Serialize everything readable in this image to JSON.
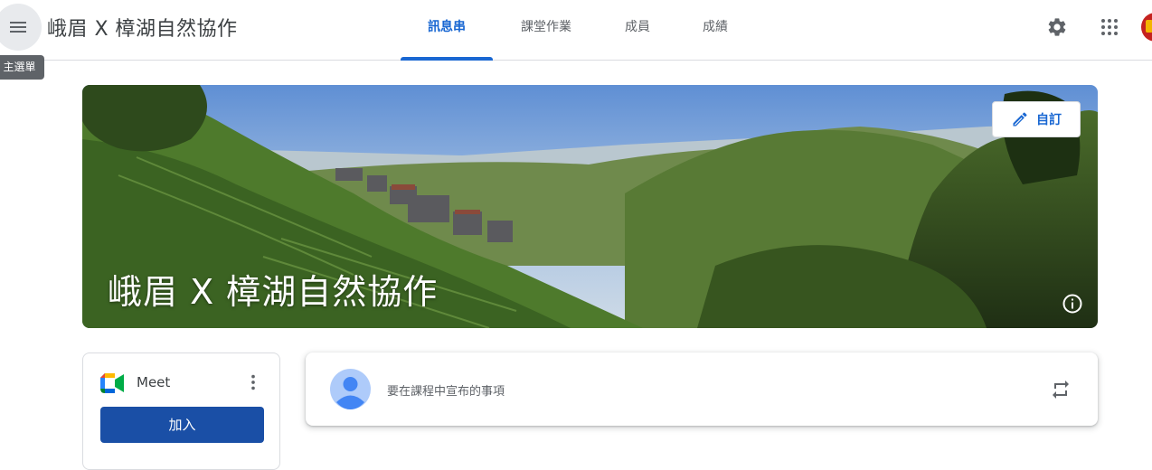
{
  "header": {
    "menu_tooltip": "主選單",
    "class_title": "峨眉 X 樟湖自然協作",
    "tabs": [
      {
        "label": "訊息串",
        "active": true
      },
      {
        "label": "課堂作業",
        "active": false
      },
      {
        "label": "成員",
        "active": false
      },
      {
        "label": "成績",
        "active": false
      }
    ],
    "icons": [
      "menu-icon",
      "gear-icon",
      "apps-grid-icon",
      "account-avatar"
    ]
  },
  "banner": {
    "title": "峨眉 X 樟湖自然協作",
    "customize_label": "自訂",
    "icons": [
      "pencil-icon",
      "info-icon"
    ]
  },
  "meet": {
    "label": "Meet",
    "join_label": "加入",
    "icons": [
      "meet-logo-icon",
      "more-vert-icon"
    ]
  },
  "stream": {
    "announce_placeholder": "要在課程中宣布的事項",
    "icons": [
      "user-avatar-icon",
      "repost-icon"
    ]
  },
  "colors": {
    "accent": "#1967d2",
    "join_button": "#1a4fa6",
    "tooltip_bg": "#5f6368",
    "divider": "#dadce0"
  }
}
